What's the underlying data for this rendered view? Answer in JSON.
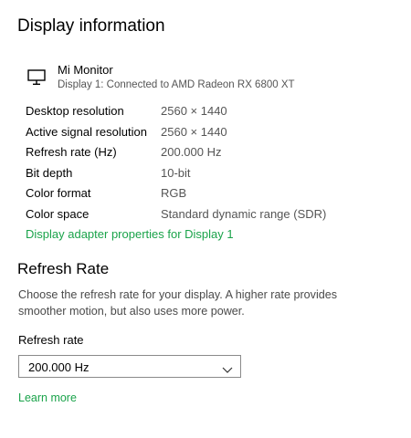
{
  "display_info": {
    "title": "Display information",
    "monitor": {
      "name": "Mi Monitor",
      "subtitle": "Display 1: Connected to AMD Radeon RX 6800 XT",
      "icon": "monitor-icon"
    },
    "rows": [
      {
        "key": "Desktop resolution",
        "value": "2560 × 1440"
      },
      {
        "key": "Active signal resolution",
        "value": "2560 × 1440"
      },
      {
        "key": "Refresh rate (Hz)",
        "value": "200.000 Hz"
      },
      {
        "key": "Bit depth",
        "value": "10-bit"
      },
      {
        "key": "Color format",
        "value": "RGB"
      },
      {
        "key": "Color space",
        "value": "Standard dynamic range (SDR)"
      }
    ],
    "adapter_link": "Display adapter properties for Display 1"
  },
  "refresh_rate": {
    "title": "Refresh Rate",
    "description": "Choose the refresh rate for your display. A higher rate provides smoother motion, but also uses more power.",
    "field_label": "Refresh rate",
    "selected": "200.000 Hz",
    "learn_more": "Learn more"
  },
  "colors": {
    "link": "#1aa34a",
    "secondary_text": "#555555"
  }
}
